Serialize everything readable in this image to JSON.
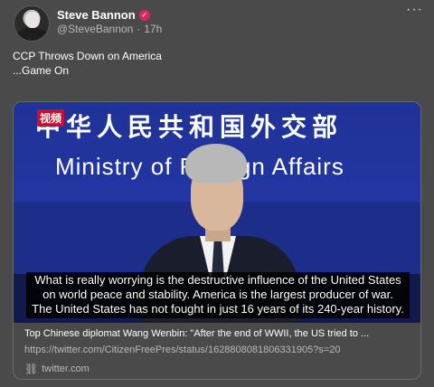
{
  "author": {
    "name": "Steve Bannon",
    "verified_icon": "verified-badge-icon",
    "handle": "@SteveBannon",
    "separator": "·",
    "time": "17h"
  },
  "menu": {
    "more_icon": "more-horizontal-icon",
    "more_glyph": "···"
  },
  "tweet": {
    "line1": "CCP Throws Down on America",
    "line2": "...Game On"
  },
  "video": {
    "channel_logo": "视频",
    "backdrop_chinese": "中华人民共和国外交部",
    "backdrop_english": "Ministry of Foreign Affairs",
    "subtitles": [
      "What is really worrying is the destructive influence of the United States",
      "on world peace and stability. America is the largest producer of war.",
      "The United States has not fought in just 16 years of its 240-year history."
    ]
  },
  "card": {
    "title": "Top Chinese diplomat Wang Wenbin: \"After the end of WWII, the US tried to ...",
    "url": "https://twitter.com/CitizenFreePres/status/1628808081806331905?s=20",
    "domain": "twitter.com",
    "link_icon": "link-icon"
  },
  "colors": {
    "background": "#4a4a4b",
    "verified": "#e0245e",
    "backdrop_blue": "#2236a4"
  }
}
